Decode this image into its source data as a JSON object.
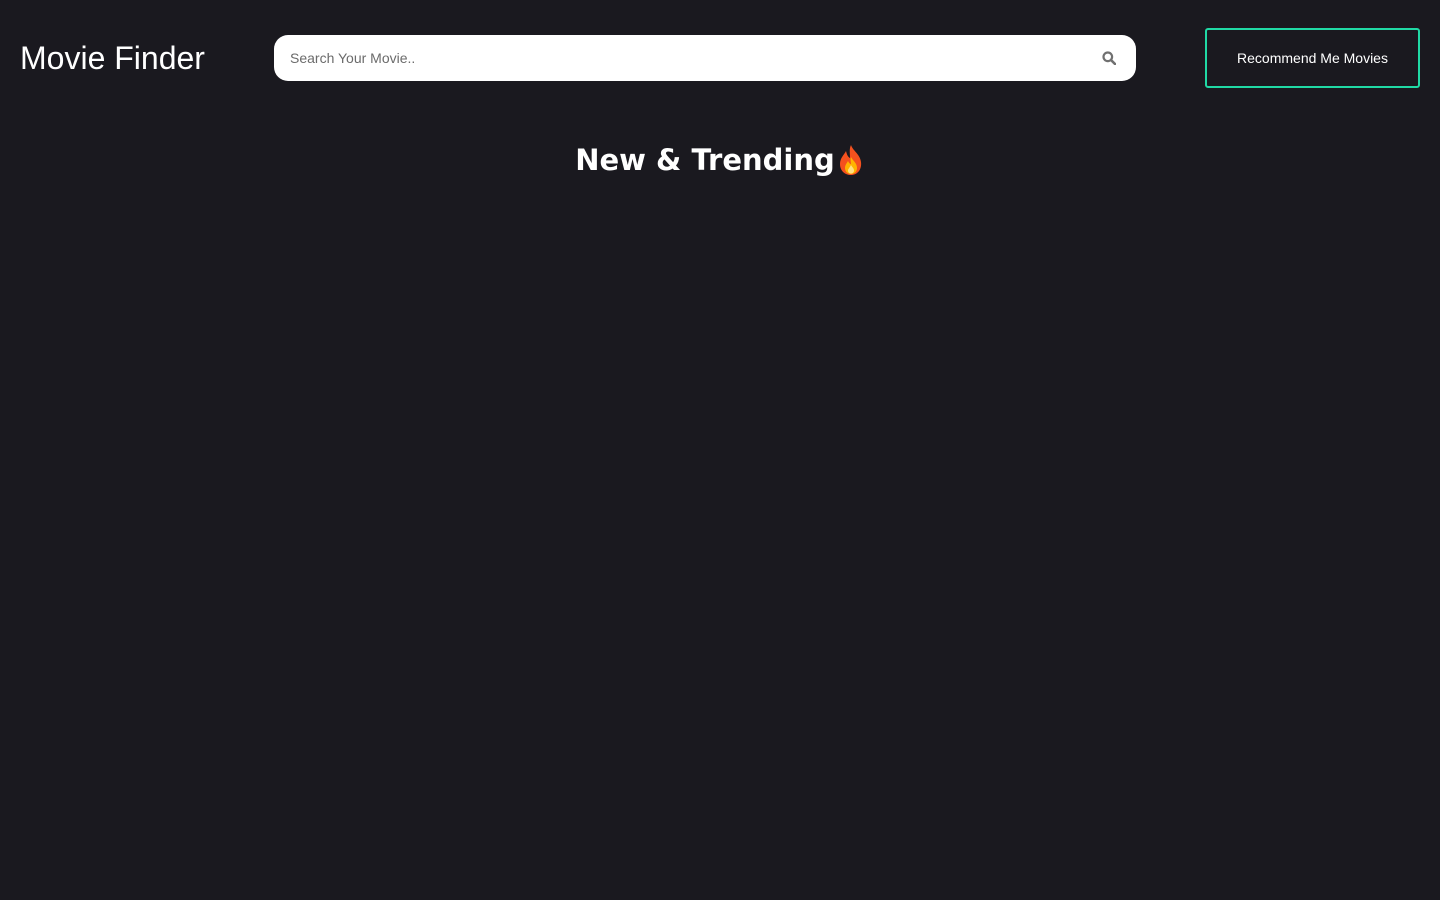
{
  "header": {
    "title": "Movie Finder",
    "search": {
      "placeholder": "Search Your Movie..",
      "value": "",
      "icon": "search-icon"
    },
    "recommend_button_label": "Recommend Me Movies",
    "accent_color": "#20d9a5"
  },
  "main": {
    "section_title": "New & Trending",
    "section_icon": "fire-icon",
    "background_color": "#1a191f"
  }
}
